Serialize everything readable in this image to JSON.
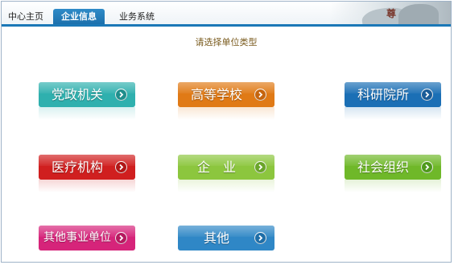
{
  "nav": {
    "tabs": [
      {
        "label": "中心主页",
        "active": false
      },
      {
        "label": "企业信息",
        "active": true
      },
      {
        "label": "业务系统",
        "active": false
      }
    ]
  },
  "banner": {
    "seal_text": "尊"
  },
  "prompt": "请选择单位类型",
  "options": [
    {
      "label": "党政机关",
      "color": "#2fb0ae",
      "arrow_color": "#1f8e8c"
    },
    {
      "label": "高等学校",
      "color": "#e07a16",
      "arrow_color": "#c6650e"
    },
    {
      "label": "科研院所",
      "color": "#1b6fb5",
      "arrow_color": "#1a5c98"
    },
    {
      "label": "医疗机构",
      "color": "#d01f1f",
      "arrow_color": "#b11616"
    },
    {
      "label": "企　业",
      "color": "#8cc63e",
      "arrow_color": "#6aa52a"
    },
    {
      "label": "社会组织",
      "color": "#6fb829",
      "arrow_color": "#4f9a1b"
    },
    {
      "label": "其他事业单位",
      "color": "#d6247a",
      "arrow_color": "#b5195f"
    },
    {
      "label": "其他",
      "color": "#2f87c6",
      "arrow_color": "#1e6ea8"
    }
  ]
}
